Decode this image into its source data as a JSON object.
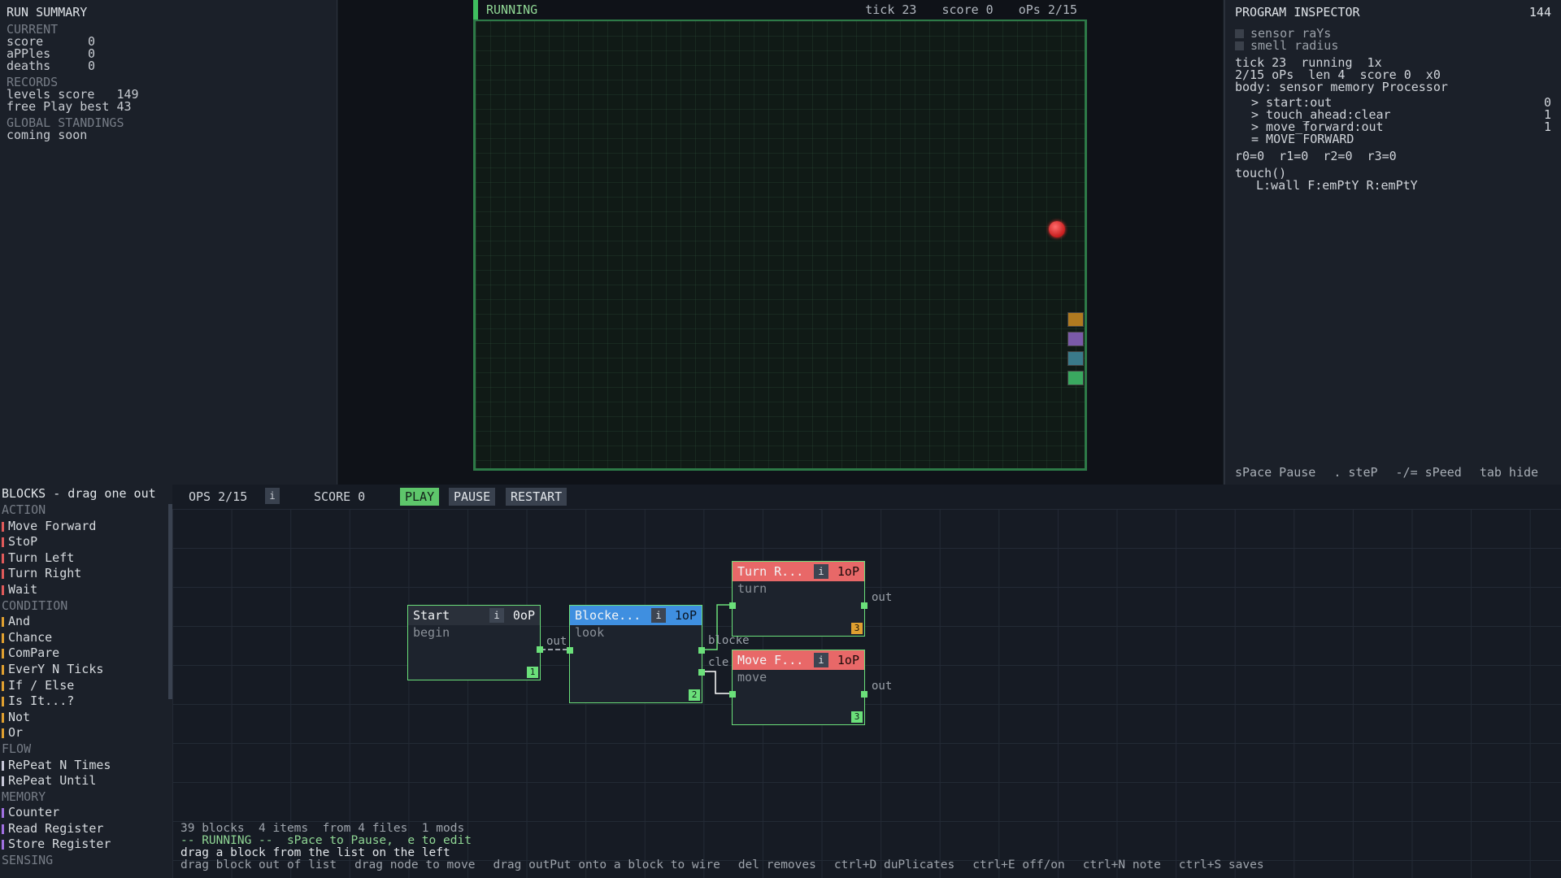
{
  "run_summary": {
    "title": "RUN SUMMARY",
    "current_label": "CURRENT",
    "current": [
      {
        "k": "score",
        "v": "0"
      },
      {
        "k": "aPPles",
        "v": "0"
      },
      {
        "k": "deaths",
        "v": "0"
      }
    ],
    "records_label": "RECORDS",
    "levels_score": "levels score   149",
    "free_play": "free Play best 43",
    "global_label": "GLOBAL STANDINGS",
    "global_value": "coming soon"
  },
  "game": {
    "status": "RUNNING",
    "tick": "tick 23",
    "score": "score 0",
    "ops": "oPs 2/15",
    "tools": [
      "tool-icon-1",
      "tool-icon-2",
      "tool-icon-3",
      "save-icon"
    ]
  },
  "inspector": {
    "title": "PROGRAM INSPECTOR",
    "count": "144",
    "checks": [
      "sensor raYs",
      "smell radius"
    ],
    "line1": "tick 23  running  1x",
    "line2": "2/15 oPs  len 4  score 0  x0",
    "line3": "body: sensor memory Processor",
    "steps": [
      {
        "t": "> start:out",
        "n": "0"
      },
      {
        "t": "> touch_ahead:clear",
        "n": "1"
      },
      {
        "t": "> move_forward:out",
        "n": "1"
      },
      {
        "t": "= MOVE FORWARD",
        "n": ""
      }
    ],
    "registers": "r0=0  r1=0  r2=0  r3=0",
    "touch_call": "touch()",
    "touch_result": "L:wall F:emPtY R:emPtY",
    "hints": [
      "sPace Pause",
      ". steP",
      "-/= sPeed",
      "tab hide"
    ]
  },
  "palette": {
    "title": "BLOCKS - drag one out",
    "action_label": "ACTION",
    "action": [
      "Move Forward",
      "StoP",
      "Turn Left",
      "Turn Right",
      "Wait"
    ],
    "condition_label": "CONDITION",
    "condition": [
      "And",
      "Chance",
      "ComPare",
      "EverY N Ticks",
      "If / Else",
      "Is It...?",
      "Not",
      "Or"
    ],
    "flow_label": "FLOW",
    "flow": [
      "RePeat N Times",
      "RePeat Until"
    ],
    "memory_label": "MEMORY",
    "memory": [
      "Counter",
      "Read Register",
      "Store Register"
    ],
    "sensing_label": "SENSING",
    "colors": {
      "action": "#e05a5a",
      "condition": "#e0a030",
      "flow": "#c8c8d8",
      "memory": "#a070e0"
    }
  },
  "toolbar": {
    "ops": "OPS 2/15",
    "info": "i",
    "score": "SCORE 0",
    "play": "PLAY",
    "pause": "PAUSE",
    "restart": "RESTART"
  },
  "nodes": {
    "start": {
      "title": "Start",
      "info": "i",
      "ops": "0oP",
      "sub": "begin",
      "num": "1",
      "port_out": "out"
    },
    "blocked": {
      "title": "Blocke...",
      "info": "i",
      "ops": "1oP",
      "sub": "look",
      "num": "2",
      "port_a": "blocke",
      "port_b": "cle"
    },
    "turn": {
      "title": "Turn R...",
      "info": "i",
      "ops": "1oP",
      "sub": "turn",
      "num": "3",
      "port_out": "out"
    },
    "move": {
      "title": "Move F...",
      "info": "i",
      "ops": "1oP",
      "sub": "move",
      "num": "3",
      "port_out": "out"
    }
  },
  "footer": {
    "stats": "39 blocks  4 items  from 4 files  1 mods",
    "running": "-- RUNNING --  sPace to Pause,  e to edit",
    "hint": "drag a block from the list on the left",
    "keys": [
      "drag block out of list",
      "drag node to move",
      "drag outPut onto a block to wire",
      "del removes",
      "ctrl+D duPlicates",
      "ctrl+E off/on",
      "ctrl+N note",
      "ctrl+S saves"
    ]
  }
}
